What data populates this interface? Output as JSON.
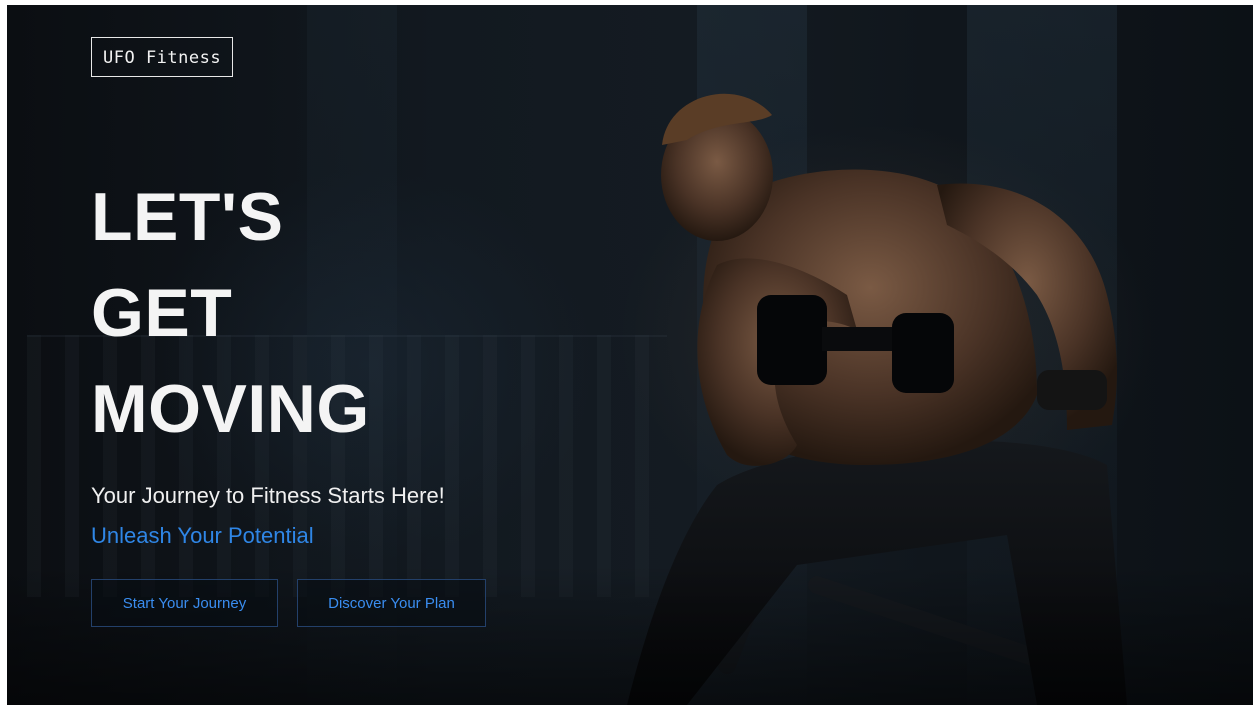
{
  "brand": {
    "logo_text": "UFO Fitness"
  },
  "hero": {
    "headline_lines": [
      "LET'S",
      "GET",
      "MOVING"
    ],
    "subtitle": "Your Journey to Fitness Starts Here!",
    "tagline": "Unleash Your Potential",
    "accent_color": "#2f86e6",
    "background_image": "athlete-dumbbell-curl"
  },
  "actions": {
    "primary_label": "Start Your Journey",
    "secondary_label": "Discover Your Plan"
  }
}
